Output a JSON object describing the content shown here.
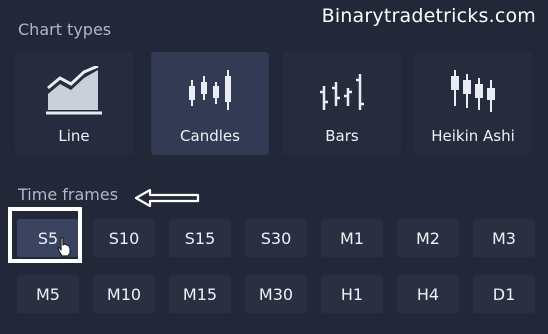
{
  "watermark": "Binarytradetricks.com",
  "chart_types": {
    "title": "Chart types",
    "items": [
      {
        "label": "Line",
        "icon": "line-chart-icon"
      },
      {
        "label": "Candles",
        "icon": "candles-chart-icon",
        "active": true
      },
      {
        "label": "Bars",
        "icon": "bars-chart-icon"
      },
      {
        "label": "Heikin Ashi",
        "icon": "heikin-ashi-chart-icon"
      }
    ]
  },
  "time_frames": {
    "title": "Time frames",
    "row1": [
      "S5",
      "S10",
      "S15",
      "S30",
      "M1",
      "M2",
      "M3"
    ],
    "row2": [
      "M5",
      "M10",
      "M15",
      "M30",
      "H1",
      "H4",
      "D1"
    ],
    "selected": "S5"
  },
  "colors": {
    "background": "#232838",
    "tile": "#262c3d",
    "tile_active": "#323b53",
    "button": "#2a3042",
    "button_active": "#3a4460",
    "section_title": "#aeb7cc",
    "text": "#eef1f6"
  }
}
